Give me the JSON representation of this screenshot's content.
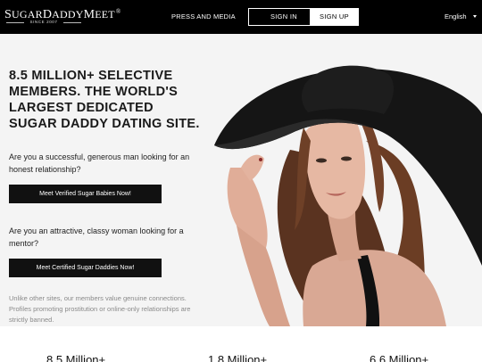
{
  "header": {
    "logo": {
      "name_sugar": "S",
      "name_rest_1": "UGAR",
      "name_daddy": "D",
      "name_rest_2": "ADDY",
      "name_meet": "M",
      "name_rest_3": "EET",
      "registered": "®",
      "since": "SINCE 2007"
    },
    "press_label": "PRESS AND MEDIA",
    "signin_label": "SIGN IN",
    "signup_label": "SIGN UP",
    "language": "English"
  },
  "hero": {
    "title": "8.5 MILLION+ SELECTIVE MEMBERS. THE WORLD'S LARGEST DEDICATED SUGAR DADDY DATING SITE.",
    "question_men": "Are you a successful, generous man looking for an honest relationship?",
    "cta_men": "Meet Verified Sugar Babies Now!",
    "question_women": "Are you an attractive, classy woman looking for a mentor?",
    "cta_women": "Meet Certified Sugar Daddies Now!",
    "note": "Unlike other sites, our members value genuine connections. Profiles promoting prostitution or online-only relationships are strictly banned."
  },
  "stats": [
    {
      "value": "8.5 Million+"
    },
    {
      "value": "1.8 Million+"
    },
    {
      "value": "6.6 Million+"
    }
  ],
  "colors": {
    "header_bg": "#000000",
    "cta_bg": "#111111",
    "hero_bg": "#f4f4f4",
    "note_text": "#8a8a8a"
  }
}
